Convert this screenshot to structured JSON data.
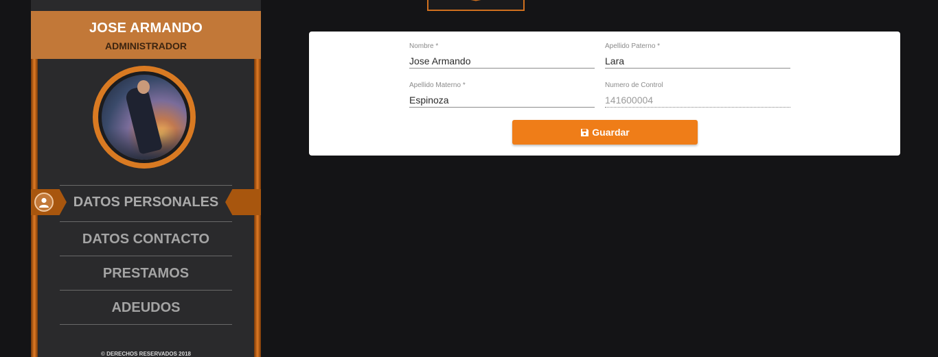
{
  "sidebar": {
    "user_name": "JOSE ARMANDO",
    "user_role": "ADMINISTRADOR",
    "menu": [
      {
        "label": "DATOS PERSONALES",
        "active": true
      },
      {
        "label": "DATOS CONTACTO",
        "active": false
      },
      {
        "label": "PRESTAMOS",
        "active": false
      },
      {
        "label": "ADEUDOS",
        "active": false
      }
    ],
    "footer": "© DERECHOS RESERVADOS 2018"
  },
  "form": {
    "nombre": {
      "label": "Nombre *",
      "value": "Jose Armando"
    },
    "apellido_paterno": {
      "label": "Apellido Paterno *",
      "value": "Lara"
    },
    "apellido_materno": {
      "label": "Apellido Materno *",
      "value": "Espinoza"
    },
    "numero_control": {
      "label": "Numero de Control",
      "value": "141600004"
    },
    "save_label": "Guardar"
  },
  "icons": {
    "active_menu_icon": "user-icon",
    "save_icon": "floppy-disk-icon"
  },
  "colors": {
    "accent": "#ef7d18",
    "header_bg": "#c27838",
    "sidebar_bg": "#2a2a2c",
    "page_bg": "#141416"
  }
}
